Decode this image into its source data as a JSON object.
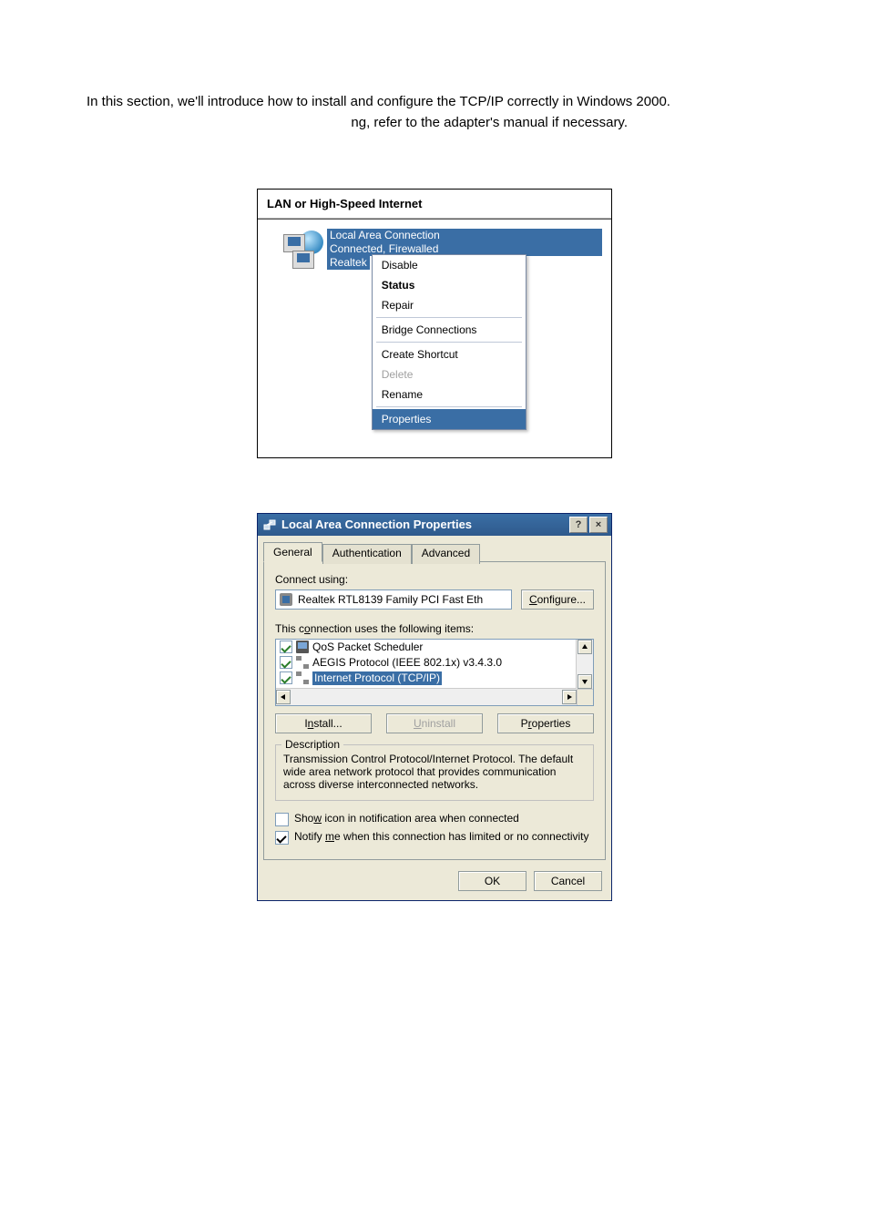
{
  "intro": {
    "p1": "In this section, we'll introduce how to install and configure the TCP/IP correctly in Windows 2000.",
    "p2": "ng, refer to the adapter's manual if necessary."
  },
  "fig1": {
    "header": "LAN or High-Speed Internet",
    "line1": "Local Area Connection",
    "line2": "Connected, Firewalled",
    "line3": "Realtek",
    "menu": {
      "disable": "Disable",
      "status": "Status",
      "repair": "Repair",
      "bridge": "Bridge Connections",
      "shortcut": "Create Shortcut",
      "delete": "Delete",
      "rename": "Rename",
      "properties": "Properties"
    }
  },
  "fig2": {
    "title_bold": "Local Area Connection",
    "title_rest": "   Properties",
    "tabs": {
      "general": "General",
      "auth": "Authentication",
      "adv": "Advanced"
    },
    "connect_using": "Connect using:",
    "adapter": "Realtek RTL8139 Family PCI Fast Eth",
    "configure": "Configure...",
    "uses_items": "This connection uses the following items:",
    "items": {
      "qos": "QoS Packet Scheduler",
      "aegis": "AEGIS Protocol (IEEE 802.1x) v3.4.3.0",
      "tcpip": "Internet Protocol (TCP/IP)"
    },
    "install": "Install...",
    "uninstall": "Uninstall",
    "properties": "Properties",
    "desc_legend": "Description",
    "desc_text": "Transmission Control Protocol/Internet Protocol. The default wide area network protocol that provides communication across diverse interconnected networks.",
    "chk_showicon": "Show icon in notification area when connected",
    "chk_notify": "Notify me when this connection has limited or no connectivity",
    "ok": "OK",
    "cancel": "Cancel"
  }
}
